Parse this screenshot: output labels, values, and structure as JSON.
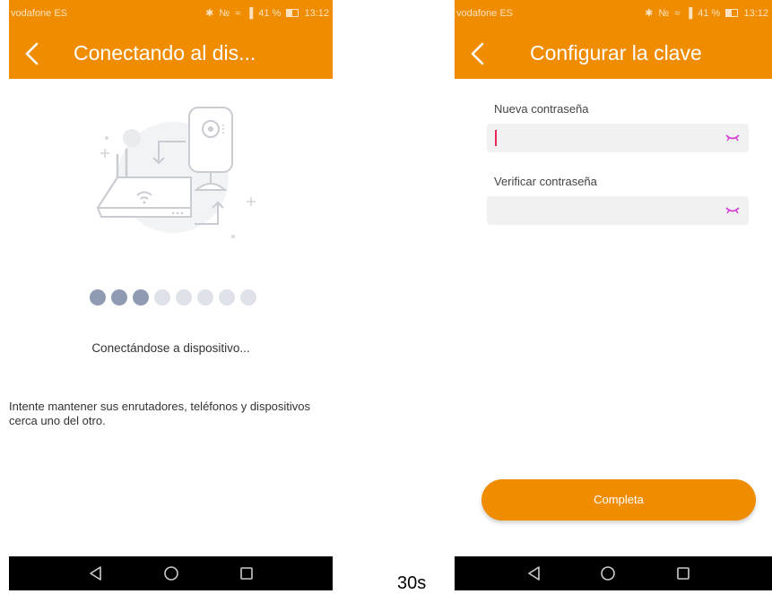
{
  "left_screen": {
    "status": {
      "carrier": "vodafone ES",
      "battery_percent": "41 %",
      "time": "13:12"
    },
    "header": {
      "title": "Conectando al dis..."
    },
    "progress": {
      "dots_total": 8,
      "dots_filled": 3,
      "filled_color": "#8e9bb2",
      "empty_color": "#dfe2e8"
    },
    "status_text": "Conectándose a dispositivo...",
    "hint_text": "Intente mantener sus enrutadores, teléfonos y dispositivos cerca uno del otro.",
    "illustration": {
      "icons": [
        "router-icon",
        "camera-icon",
        "wifi-icon"
      ]
    }
  },
  "right_screen": {
    "status": {
      "carrier": "vodafone ES",
      "battery_percent": "41 %",
      "time": "13:12"
    },
    "header": {
      "title": "Configurar la clave"
    },
    "form": {
      "new_password_label": "Nueva contraseña",
      "new_password_value": "",
      "verify_password_label": "Verificar contraseña",
      "verify_password_value": ""
    },
    "submit_label": "Completa"
  },
  "between_label": "30s",
  "colors": {
    "accent": "#f08c00",
    "eye_icon": "#d63fd6",
    "cursor": "#e8285a"
  }
}
